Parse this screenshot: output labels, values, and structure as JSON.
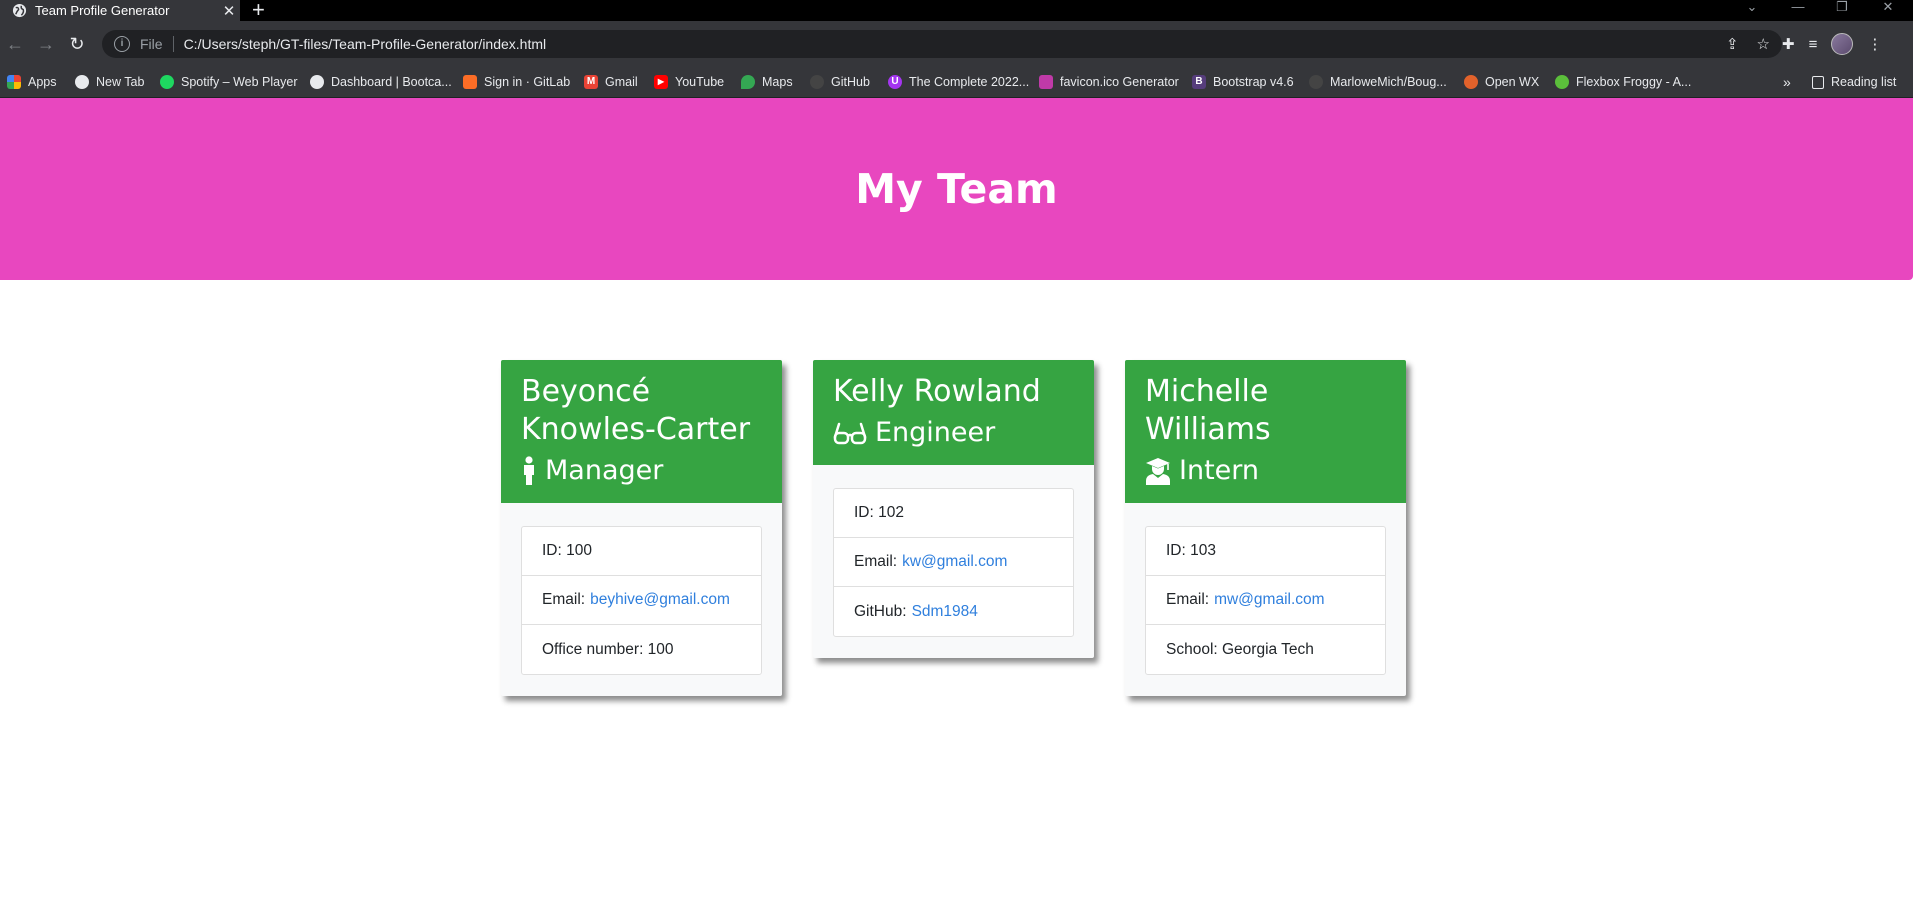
{
  "browser": {
    "tab_title": "Team Profile Generator",
    "address_scheme": "File",
    "address_url": "C:/Users/steph/GT-files/Team-Profile-Generator/index.html",
    "bookmarks": [
      {
        "label": "Apps",
        "icon": "apps-grid-icon",
        "color": "#ea4335"
      },
      {
        "label": "New Tab",
        "icon": "globe-icon",
        "color": "#9aa0a6"
      },
      {
        "label": "Spotify – Web Player",
        "icon": "spotify-icon",
        "color": "#1ed760"
      },
      {
        "label": "Dashboard | Bootca...",
        "icon": "globe-icon",
        "color": "#9aa0a6"
      },
      {
        "label": "Sign in · GitLab",
        "icon": "gitlab-icon",
        "color": "#fc6d26"
      },
      {
        "label": "Gmail",
        "icon": "gmail-icon",
        "color": "#ea4335"
      },
      {
        "label": "YouTube",
        "icon": "youtube-icon",
        "color": "#ff0000"
      },
      {
        "label": "Maps",
        "icon": "maps-icon",
        "color": "#34a853"
      },
      {
        "label": "GitHub",
        "icon": "github-icon",
        "color": "#444444"
      },
      {
        "label": "The Complete 2022...",
        "icon": "udemy-icon",
        "color": "#a435f0"
      },
      {
        "label": "favicon.ico Generator",
        "icon": "favicon-generator-icon",
        "color": "#c03aa8"
      },
      {
        "label": "Bootstrap v4.6",
        "icon": "bootstrap-icon",
        "color": "#563d7c"
      },
      {
        "label": "MarloweMich/Boug...",
        "icon": "github-icon",
        "color": "#444444"
      },
      {
        "label": "Open WX",
        "icon": "openwx-icon",
        "color": "#e2622b"
      },
      {
        "label": "Flexbox Froggy - A...",
        "icon": "frog-icon",
        "color": "#5bbf3b"
      }
    ],
    "reading_list": "Reading list"
  },
  "page": {
    "heading": "My Team",
    "cards": [
      {
        "name_line1": "Beyoncé",
        "name_line2": "Knowles-Carter",
        "role": "Manager",
        "role_icon": "person-icon",
        "items": [
          {
            "label": "ID: 100",
            "link": ""
          },
          {
            "label": "Email:",
            "link": "beyhive@gmail.com"
          },
          {
            "label": "Office number: 100",
            "link": ""
          }
        ]
      },
      {
        "name_line1": "Kelly Rowland",
        "name_line2": "",
        "role": "Engineer",
        "role_icon": "glasses-icon",
        "items": [
          {
            "label": "ID: 102",
            "link": ""
          },
          {
            "label": "Email:",
            "link": "kw@gmail.com"
          },
          {
            "label": "GitHub:",
            "link": "Sdm1984"
          }
        ]
      },
      {
        "name_line1": "Michelle",
        "name_line2": "Williams",
        "role": "Intern",
        "role_icon": "graduate-icon",
        "items": [
          {
            "label": "ID: 103",
            "link": ""
          },
          {
            "label": "Email:",
            "link": "mw@gmail.com"
          },
          {
            "label": "School: Georgia Tech",
            "link": ""
          }
        ]
      }
    ]
  },
  "colors": {
    "header_bg": "#e847bf",
    "card_header_bg": "#36a442",
    "link": "#2f7fdd"
  }
}
